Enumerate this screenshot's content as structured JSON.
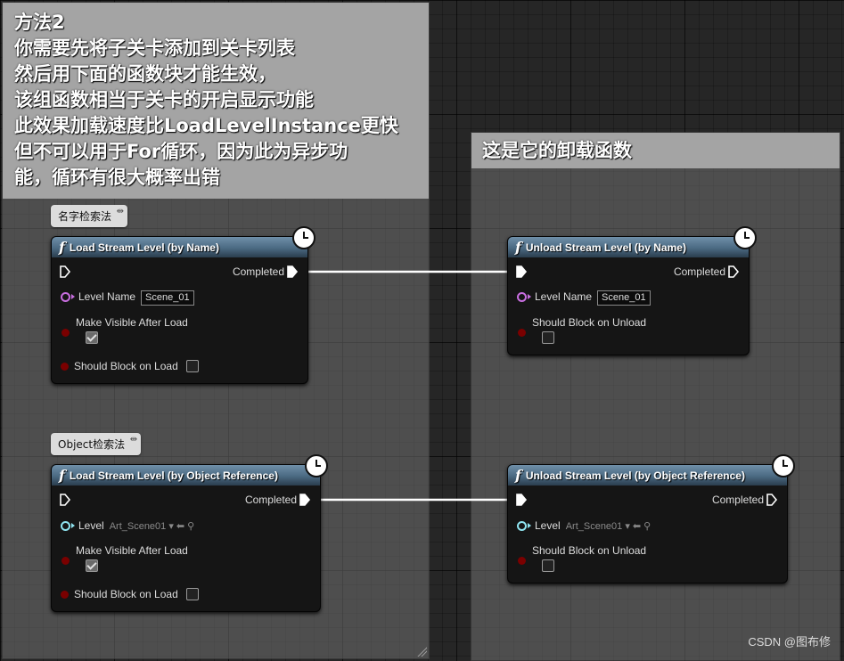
{
  "comments": {
    "method": {
      "lines": [
        "方法2",
        "你需要先将子关卡添加到关卡列表",
        "然后用下面的函数块才能生效，",
        "该组函数相当于关卡的开启显示功能",
        "此效果加载速度比LoadLevelInstance更快",
        "但不可以用于For循环，因为此为异步功",
        "能，循环有很大概率出错"
      ]
    },
    "unload": {
      "title": "这是它的卸载函数"
    }
  },
  "bubbles": {
    "by_name": "名字检索法",
    "by_object": "Object检索法"
  },
  "nodes": {
    "load_by_name": {
      "title": "Load Stream Level (by Name)",
      "completed": "Completed",
      "level_label": "Level Name",
      "level_value": "Scene_01",
      "make_visible": "Make Visible After Load",
      "make_visible_checked": true,
      "block": "Should Block on Load",
      "block_checked": false
    },
    "unload_by_name": {
      "title": "Unload Stream Level (by Name)",
      "completed": "Completed",
      "level_label": "Level Name",
      "level_value": "Scene_01",
      "block": "Should Block on Unload",
      "block_checked": false
    },
    "load_by_object": {
      "title": "Load Stream Level (by Object Reference)",
      "completed": "Completed",
      "level_label": "Level",
      "level_value": "Art_Scene01",
      "make_visible": "Make Visible After Load",
      "make_visible_checked": true,
      "block": "Should Block on Load",
      "block_checked": false
    },
    "unload_by_object": {
      "title": "Unload Stream Level (by Object Reference)",
      "completed": "Completed",
      "level_label": "Level",
      "level_value": "Art_Scene01",
      "block": "Should Block on Unload",
      "block_checked": false
    }
  },
  "watermark": "CSDN @图布修",
  "colors": {
    "node_header": "#4b6a82",
    "pin_string": "#c86ee0",
    "pin_bool": "#7a0000",
    "pin_object": "#8fe4f0",
    "wire": "#ffffff"
  }
}
